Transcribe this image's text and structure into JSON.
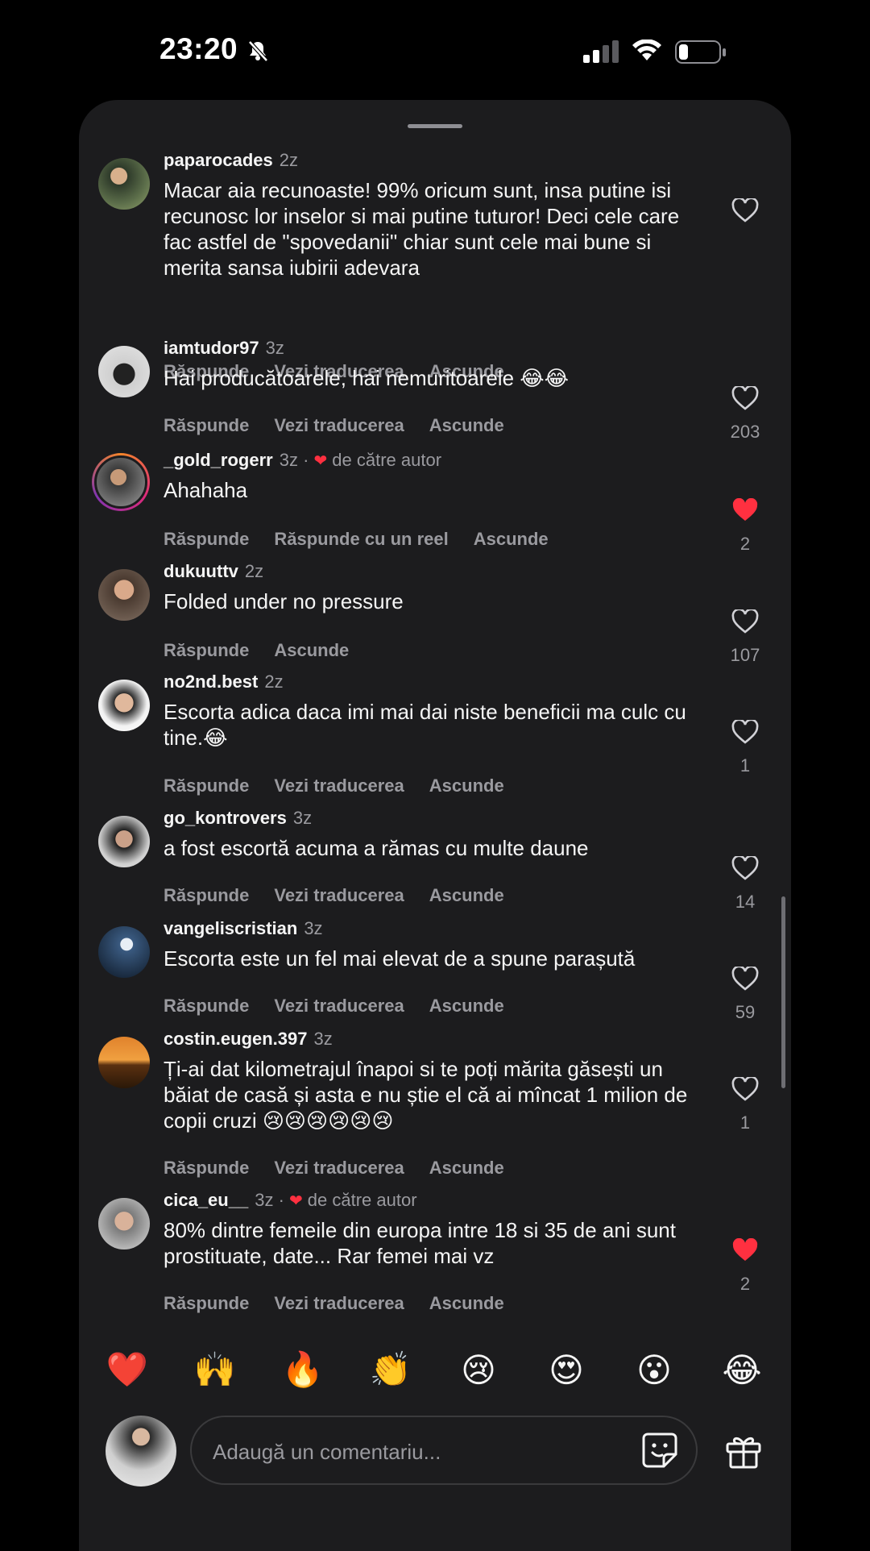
{
  "status_bar": {
    "time": "23:20"
  },
  "comments": [
    {
      "username": "paparocades",
      "age": "2z",
      "by_author": false,
      "text": "Macar aia recunoaste! 99% oricum sunt, insa putine isi recunosc lor inselor si mai putine tuturor! Deci cele care fac astfel de \"spovedanii\" chiar sunt cele mai bune si merita sansa iubirii adevara",
      "actions": [
        "Răspunde",
        "Vezi traducerea",
        "Ascunde"
      ],
      "liked": false,
      "likes": ""
    },
    {
      "username": "iamtudor97",
      "age": "3z",
      "by_author": false,
      "text": "Hai producătoarele, hai nemuritoarele 😂😂",
      "actions": [
        "Răspunde",
        "Vezi traducerea",
        "Ascunde"
      ],
      "liked": false,
      "likes": "203"
    },
    {
      "username": "_gold_rogerr",
      "age": "3z",
      "by_author": true,
      "author_label": "de către autor",
      "text": "Ahahaha",
      "actions": [
        "Răspunde",
        "Răspunde cu un reel",
        "Ascunde"
      ],
      "liked": true,
      "likes": "2"
    },
    {
      "username": "dukuuttv",
      "age": "2z",
      "by_author": false,
      "text": "Folded under no pressure",
      "actions": [
        "Răspunde",
        "Ascunde"
      ],
      "liked": false,
      "likes": "107"
    },
    {
      "username": "no2nd.best",
      "age": "2z",
      "by_author": false,
      "text": "Escorta adica daca imi mai dai niste beneficii ma culc cu tine.😂",
      "actions": [
        "Răspunde",
        "Vezi traducerea",
        "Ascunde"
      ],
      "liked": false,
      "likes": "1"
    },
    {
      "username": "go_kontrovers",
      "age": "3z",
      "by_author": false,
      "text": "a fost escortă acuma a rămas  cu multe daune",
      "actions": [
        "Răspunde",
        "Vezi traducerea",
        "Ascunde"
      ],
      "liked": false,
      "likes": "14"
    },
    {
      "username": "vangeliscristian",
      "age": "3z",
      "by_author": false,
      "text": "Escorta este un fel mai elevat de a spune parașută",
      "actions": [
        "Răspunde",
        "Vezi traducerea",
        "Ascunde"
      ],
      "liked": false,
      "likes": "59"
    },
    {
      "username": "costin.eugen.397",
      "age": "3z",
      "by_author": false,
      "text": "Ți-ai dat kilometrajul înapoi si te poți mărita găsești un băiat de casă și asta e nu știe el că ai mîncat 1 milion de copii cruzi 😢😢😢😢😢😢",
      "actions": [
        "Răspunde",
        "Vezi traducerea",
        "Ascunde"
      ],
      "liked": false,
      "likes": "1"
    },
    {
      "username": "cica_eu__",
      "age": "3z",
      "by_author": true,
      "author_label": "de către autor",
      "text": "80% dintre femeile din europa intre 18 si 35 de ani sunt prostituate, date... Rar femei mai vz",
      "actions": [
        "Răspunde",
        "Vezi traducerea",
        "Ascunde"
      ],
      "liked": true,
      "likes": "2"
    }
  ],
  "reactions": [
    "❤️",
    "🙌",
    "🔥",
    "👏",
    "😢",
    "😍",
    "😮",
    "😂"
  ],
  "composer": {
    "placeholder": "Adaugă un comentariu..."
  },
  "colors": {
    "background": "#1c1c1e",
    "liked_heart": "#ff3040",
    "secondary_text": "#9a9a9f"
  }
}
